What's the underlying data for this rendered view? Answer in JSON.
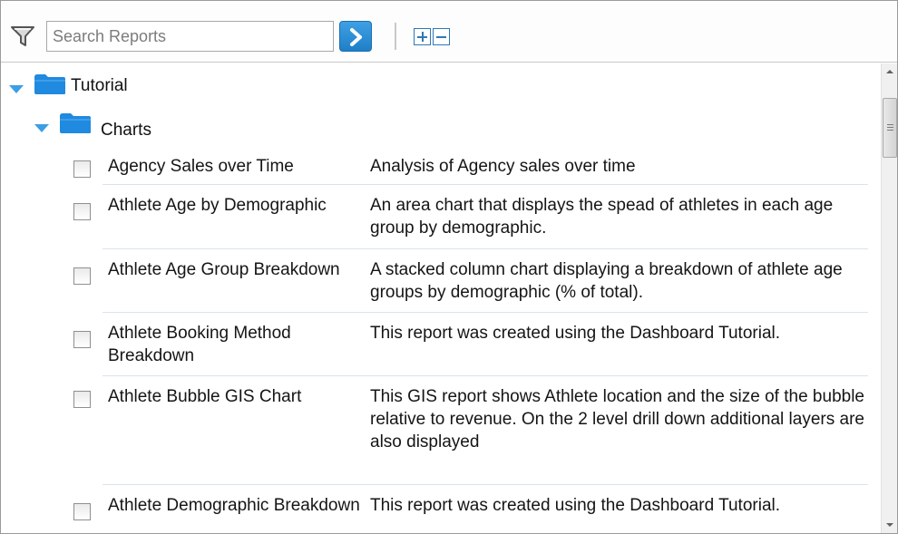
{
  "toolbar": {
    "search_placeholder": "Search Reports",
    "icons": [
      "filter-icon",
      "go-arrow-icon",
      "expand-all-icon",
      "collapse-all-icon"
    ]
  },
  "tree": {
    "root_label": "Tutorial",
    "folder_label": "Charts",
    "accent_color": "#3c9ee6",
    "reports": [
      {
        "name": "Agency Sales over Time",
        "description": "Analysis of Agency sales over time"
      },
      {
        "name": "Athlete Age by Demographic",
        "description": "An area chart that displays the spead of athletes in each age group by demographic."
      },
      {
        "name": "Athlete Age Group Breakdown",
        "description": "A stacked column chart displaying a breakdown of athlete age groups by demographic (% of total)."
      },
      {
        "name": "Athlete Booking Method Breakdown",
        "description": "This report was created using the Dashboard Tutorial."
      },
      {
        "name": "Athlete Bubble GIS Chart",
        "description": "This GIS report shows Athlete location and the size of the bubble relative to revenue. On the 2 level drill down additional layers are also displayed"
      },
      {
        "name": "Athlete Demographic Breakdown",
        "description": "This report was created using the Dashboard Tutorial."
      }
    ]
  }
}
